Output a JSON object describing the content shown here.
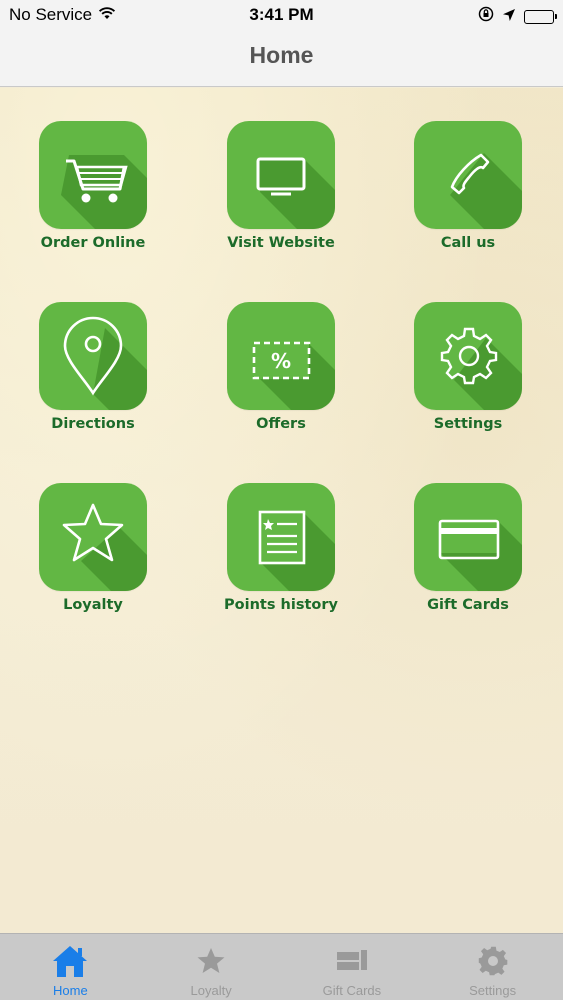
{
  "status_bar": {
    "carrier": "No Service",
    "time": "3:41 PM"
  },
  "nav": {
    "title": "Home"
  },
  "tiles": [
    {
      "label": "Order Online",
      "icon": "cart-icon"
    },
    {
      "label": "Visit Website",
      "icon": "monitor-icon"
    },
    {
      "label": "Call us",
      "icon": "phone-icon"
    },
    {
      "label": "Directions",
      "icon": "map-pin-icon"
    },
    {
      "label": "Offers",
      "icon": "coupon-icon"
    },
    {
      "label": "Settings",
      "icon": "gear-icon"
    },
    {
      "label": "Loyalty",
      "icon": "star-icon"
    },
    {
      "label": "Points history",
      "icon": "document-icon"
    },
    {
      "label": "Gift Cards",
      "icon": "credit-card-icon"
    }
  ],
  "tabbar": {
    "tabs": [
      {
        "label": "Home",
        "icon": "home-icon",
        "active": true
      },
      {
        "label": "Loyalty",
        "icon": "star-icon",
        "active": false
      },
      {
        "label": "Gift Cards",
        "icon": "gift-cards-icon",
        "active": false
      },
      {
        "label": "Settings",
        "icon": "gear-icon",
        "active": false
      }
    ]
  },
  "colors": {
    "tile_green": "#62b744",
    "tile_shadow": "#4a9a30",
    "label_green": "#1c6b2a",
    "tab_active": "#1a7ee8",
    "tab_inactive": "#9a9a9a",
    "background": "#f3ecd6"
  }
}
